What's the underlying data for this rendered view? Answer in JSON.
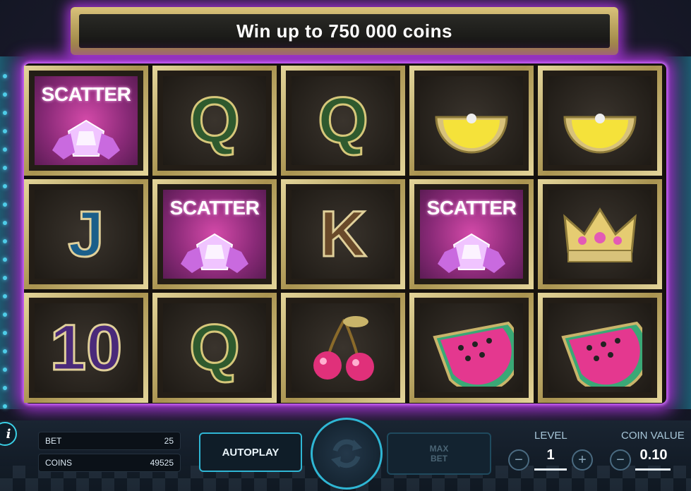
{
  "banner": {
    "text": "Win up to 750 000 coins"
  },
  "grid": {
    "rows": [
      [
        {
          "symbol": "scatter",
          "label": "SCATTER"
        },
        {
          "symbol": "q",
          "label": "Q"
        },
        {
          "symbol": "q",
          "label": "Q"
        },
        {
          "symbol": "lemon",
          "label": ""
        },
        {
          "symbol": "lemon",
          "label": ""
        }
      ],
      [
        {
          "symbol": "j",
          "label": "J"
        },
        {
          "symbol": "scatter",
          "label": "SCATTER"
        },
        {
          "symbol": "k",
          "label": "K"
        },
        {
          "symbol": "scatter",
          "label": "SCATTER"
        },
        {
          "symbol": "crown",
          "label": ""
        }
      ],
      [
        {
          "symbol": "ten",
          "label": "10"
        },
        {
          "symbol": "q",
          "label": "Q"
        },
        {
          "symbol": "cherry",
          "label": ""
        },
        {
          "symbol": "watermelon",
          "label": ""
        },
        {
          "symbol": "watermelon",
          "label": ""
        }
      ]
    ]
  },
  "info": {
    "label": "i"
  },
  "bet": {
    "label": "BET",
    "value": "25"
  },
  "coins": {
    "label": "COINS",
    "value": "49525"
  },
  "autoplay": {
    "label": "AUTOPLAY"
  },
  "maxbet": {
    "line1": "MAX",
    "line2": "BET"
  },
  "level": {
    "label": "LEVEL",
    "value": "1",
    "minus": "−",
    "plus": "+"
  },
  "coin_value": {
    "label": "COIN VALUE",
    "value": "0.10",
    "minus": "−"
  },
  "colors": {
    "accent": "#2fb6d4",
    "glow": "#c83cff",
    "gold": "#d9c27a",
    "scatter_bg": "#d44aa9"
  }
}
